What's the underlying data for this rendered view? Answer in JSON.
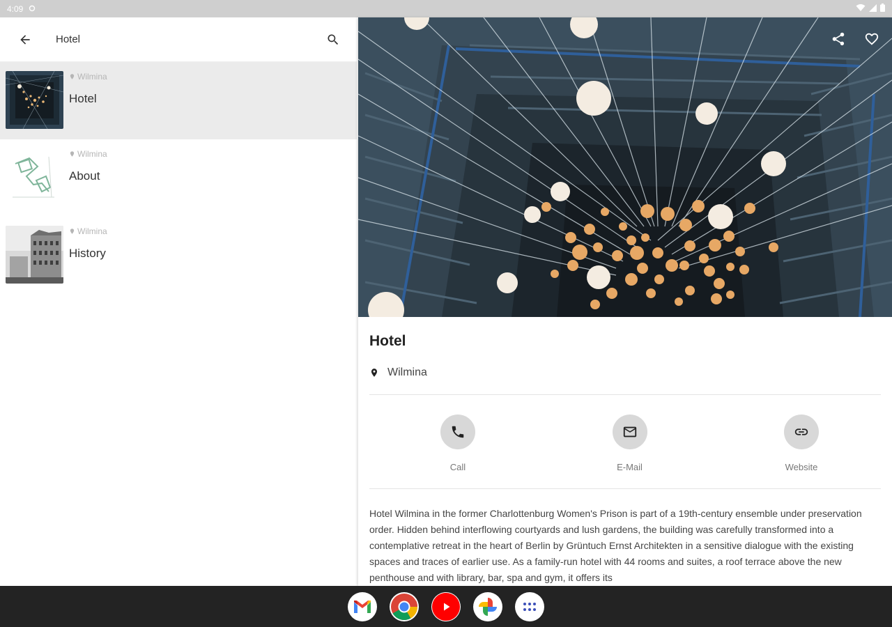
{
  "status_bar": {
    "time": "4:09"
  },
  "search": {
    "query": "Hotel"
  },
  "results": [
    {
      "location": "Wilmina",
      "title": "Hotel",
      "selected": true
    },
    {
      "location": "Wilmina",
      "title": "About",
      "selected": false
    },
    {
      "location": "Wilmina",
      "title": "History",
      "selected": false
    }
  ],
  "detail": {
    "title": "Hotel",
    "location": "Wilmina",
    "contacts": {
      "call": "Call",
      "email": "E-Mail",
      "website": "Website"
    },
    "description": "Hotel Wilmina in the former Charlottenburg Women's Prison is part of a 19th-century ensemble under preservation order. Hidden behind interflowing courtyards and lush gardens, the building was carefully transformed into a contemplative retreat in the heart of Berlin by Grüntuch Ernst Architekten in a sensitive dialogue with the existing spaces and traces of earlier use. As a family-run hotel with 44 rooms and suites, a roof terrace above the new penthouse and with library, bar, spa and gym, it offers its"
  },
  "icons": {
    "back": "arrow-left-icon",
    "search": "search-icon",
    "share": "share-icon",
    "favorite": "heart-icon",
    "location": "map-pin-icon",
    "call": "phone-icon",
    "email": "mail-icon",
    "website": "link-icon"
  },
  "dock_apps": [
    "gmail-icon",
    "chrome-icon",
    "youtube-icon",
    "photos-icon",
    "app-drawer-icon"
  ],
  "colors": {
    "selected_row": "#ebebeb",
    "action_circle": "#d8d8d8",
    "navbar": "#232323",
    "status_bar": "#cfcfcf"
  }
}
